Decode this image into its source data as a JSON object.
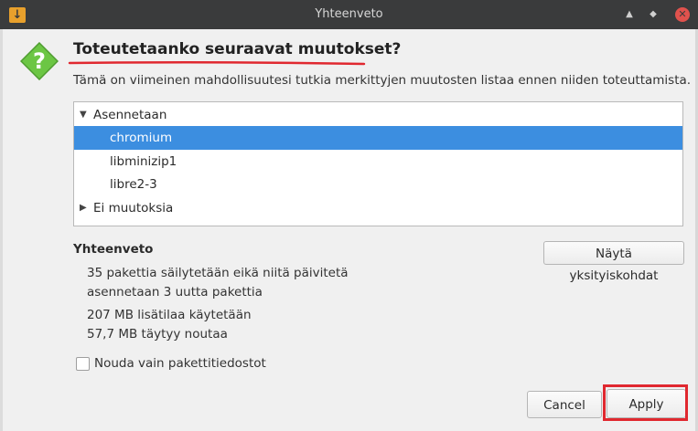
{
  "window": {
    "title": "Yhteenveto",
    "app_icon_glyph": "↓",
    "controls": {
      "shade": "▲",
      "maximize": "◆",
      "close": "✕"
    }
  },
  "heading": "Toteutetaanko seuraavat muutokset?",
  "description": "Tämä on viimeinen mahdollisuutesi tutkia merkittyjen muutosten listaa ennen niiden toteuttamista.",
  "tree": {
    "groups": [
      {
        "label": "Asennetaan",
        "expanded": true,
        "arrow": "▼",
        "items": [
          "chromium",
          "libminizip1",
          "libre2-3"
        ],
        "selected_index": 0
      },
      {
        "label": "Ei muutoksia",
        "expanded": false,
        "arrow": "▶",
        "items": []
      }
    ]
  },
  "summary": {
    "title": "Yhteenveto",
    "lines": [
      "35 pakettia säilytetään eikä niitä päivitetä",
      "asennetaan 3 uutta pakettia",
      "207 MB lisätilaa käytetään",
      "57,7 MB täytyy noutaa"
    ],
    "details_button": "Näytä yksityiskohdat"
  },
  "download_only": {
    "label": "Nouda vain pakettitiedostot",
    "checked": false
  },
  "buttons": {
    "cancel": "Cancel",
    "apply": "Apply"
  },
  "colors": {
    "selection": "#3c8ee0",
    "question_icon": "#6cc644",
    "annotation": "#e0282f",
    "titlebar": "#3a3b3c"
  },
  "icons": {
    "dialog": "question-icon"
  }
}
